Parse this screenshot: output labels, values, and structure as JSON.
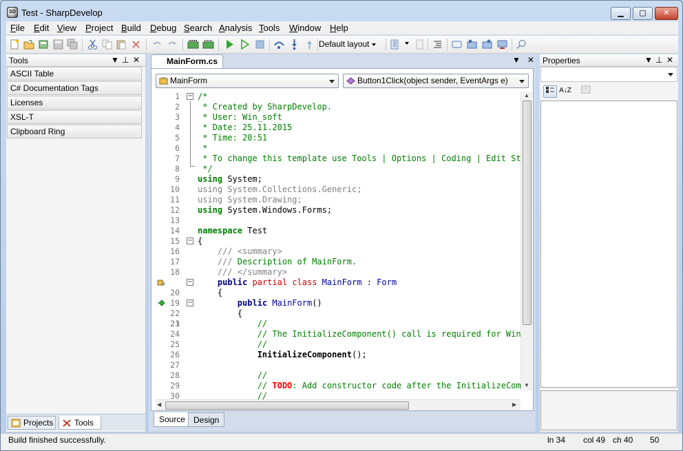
{
  "window": {
    "title": "Test - SharpDevelop",
    "app_icon_text": "SD"
  },
  "caption_buttons": {
    "minimize": "▁",
    "maximize": "▢",
    "close": "✕"
  },
  "menu": [
    {
      "label": "File",
      "key": "F",
      "rest": "ile"
    },
    {
      "label": "Edit",
      "key": "E",
      "rest": "dit"
    },
    {
      "label": "View",
      "key": "V",
      "rest": "iew"
    },
    {
      "label": "Project",
      "key": "P",
      "rest": "roject"
    },
    {
      "label": "Build",
      "key": "B",
      "rest": "uild"
    },
    {
      "label": "Debug",
      "key": "D",
      "rest": "ebug"
    },
    {
      "label": "Search",
      "key": "S",
      "rest": "earch"
    },
    {
      "label": "Analysis",
      "key": "A",
      "rest": "nalysis"
    },
    {
      "label": "Tools",
      "key": "T",
      "rest": "ools"
    },
    {
      "label": "Window",
      "key": "W",
      "rest": "indow"
    },
    {
      "label": "Help",
      "key": "H",
      "rest": "elp"
    }
  ],
  "toolbar": {
    "layout_label": "Default layout"
  },
  "tools_pad": {
    "title": "Tools",
    "categories": [
      "ASCII Table",
      "C# Documentation Tags",
      "Licenses",
      "XSL-T",
      "Clipboard Ring"
    ],
    "tabs": [
      "Projects",
      "Tools"
    ]
  },
  "editor": {
    "doc_tab": "MainForm.cs",
    "class_combo": "MainForm",
    "member_combo": "Button1Click(object sender, EventArgs e)",
    "bottom_tabs": [
      "Source",
      "Design"
    ],
    "line_numbers": [
      "1",
      "2",
      "3",
      "4",
      "5",
      "6",
      "7",
      "8",
      "9",
      "10",
      "11",
      "12",
      "13",
      "14",
      "15",
      "16",
      "17",
      "18",
      "19",
      "20",
      "21",
      "22",
      "23",
      "24",
      "25",
      "26",
      "27",
      "28",
      "29",
      "30"
    ]
  },
  "properties_pad": {
    "title": "Properties",
    "sort_az": "A↓Z"
  },
  "pad_controls": {
    "menu": "▼",
    "pin": "⊥",
    "close": "✕"
  },
  "status": {
    "message": "Build finished successfully.",
    "line": "ln 34",
    "col": "col 49",
    "ch": "ch 40",
    "extra": "50"
  },
  "colors": {
    "comment": "#008000",
    "keyword": "#0000ff",
    "doc": "#808080"
  }
}
